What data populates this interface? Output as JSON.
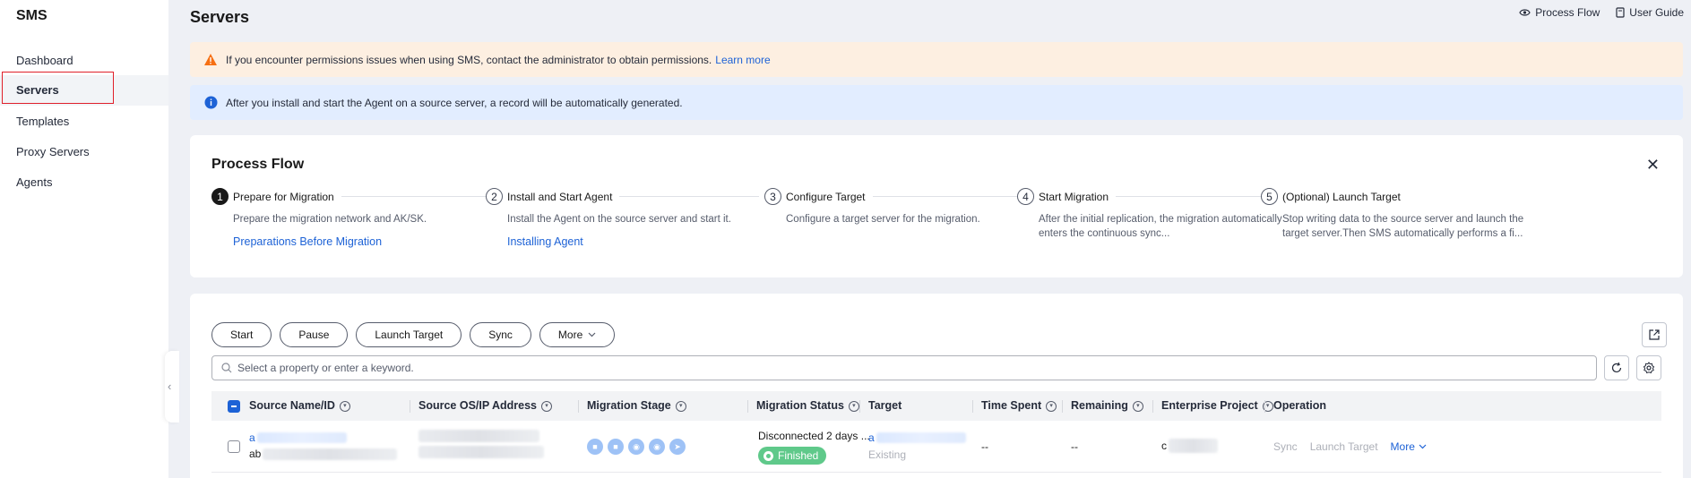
{
  "sidebar": {
    "brand": "SMS",
    "items": [
      {
        "label": "Dashboard"
      },
      {
        "label": "Servers"
      },
      {
        "label": "Templates"
      },
      {
        "label": "Proxy Servers"
      },
      {
        "label": "Agents"
      }
    ],
    "active_index": 1
  },
  "header": {
    "title": "Servers",
    "process_flow_link": "Process Flow",
    "user_guide_link": "User Guide"
  },
  "banners": {
    "warning_text": "If you encounter permissions issues when using SMS, contact the administrator to obtain permissions.",
    "warning_link": "Learn more",
    "info_text": "After you install and start the Agent on a source server, a record will be automatically generated."
  },
  "process_flow": {
    "title": "Process Flow",
    "steps": [
      {
        "num": "1",
        "label": "Prepare for Migration",
        "desc": "Prepare the migration network and AK/SK.",
        "link": "Preparations Before Migration"
      },
      {
        "num": "2",
        "label": "Install and Start Agent",
        "desc": "Install the Agent on the source server and start it.",
        "link": "Installing Agent"
      },
      {
        "num": "3",
        "label": "Configure Target",
        "desc": "Configure a target server for the migration.",
        "link": ""
      },
      {
        "num": "4",
        "label": "Start Migration",
        "desc": "After the initial replication, the migration automatically enters the continuous sync...",
        "link": ""
      },
      {
        "num": "5",
        "label": "(Optional) Launch Target",
        "desc": "Stop writing data to the source server and launch the target server.Then SMS automatically performs a fi...",
        "link": ""
      }
    ]
  },
  "toolbar": {
    "start": "Start",
    "pause": "Pause",
    "launch_target": "Launch Target",
    "sync": "Sync",
    "more": "More",
    "search_placeholder": "Select a property or enter a keyword."
  },
  "table": {
    "columns": [
      "Source Name/ID",
      "Source OS/IP Address",
      "Migration Stage",
      "Migration Status",
      "Target",
      "Time Spent",
      "Remaining",
      "Enterprise Project",
      "Operation"
    ],
    "rows": [
      {
        "name_prefix": "a",
        "id_prefix": "ab",
        "status_text": "Disconnected 2 days ...",
        "status_badge": "Finished",
        "target_prefix": "a",
        "target_sub": "Existing",
        "time_spent": "--",
        "remaining": "--",
        "enterprise_prefix": "c",
        "op_sync": "Sync",
        "op_launch": "Launch Target",
        "op_more": "More"
      }
    ]
  },
  "colors": {
    "accent": "#1d62d6",
    "warning_bg": "#fdefe1",
    "info_bg": "#e2edff",
    "success": "#5fc98a",
    "highlight_border": "#e0202a"
  }
}
